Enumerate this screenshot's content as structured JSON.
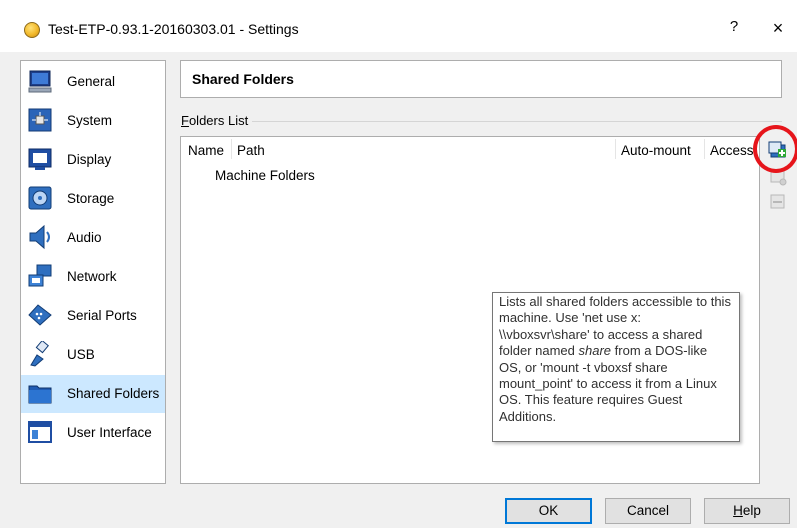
{
  "window": {
    "title": "Test-ETP-0.93.1-20160303.01 - Settings",
    "help_label": "?",
    "close_label": "×"
  },
  "sidebar": {
    "items": [
      {
        "label": "General",
        "icon": "monitor-icon"
      },
      {
        "label": "System",
        "icon": "chip-icon"
      },
      {
        "label": "Display",
        "icon": "display-icon"
      },
      {
        "label": "Storage",
        "icon": "disk-icon"
      },
      {
        "label": "Audio",
        "icon": "speaker-icon"
      },
      {
        "label": "Network",
        "icon": "network-icon"
      },
      {
        "label": "Serial Ports",
        "icon": "serial-port-icon"
      },
      {
        "label": "USB",
        "icon": "usb-icon"
      },
      {
        "label": "Shared Folders",
        "icon": "folder-icon",
        "selected": true
      },
      {
        "label": "User Interface",
        "icon": "window-icon"
      }
    ]
  },
  "page": {
    "title": "Shared Folders",
    "group_label_accel": "F",
    "group_label_rest": "olders List"
  },
  "table": {
    "columns": [
      "Name",
      "Path",
      "Auto-mount",
      "Access"
    ],
    "rows": [
      {
        "label": "Machine Folders"
      }
    ]
  },
  "tooltip": {
    "text_before": "Lists all shared folders accessible to this machine. Use 'net use x: \\\\vboxsvr\\share' to access a shared folder named ",
    "text_em": "share",
    "text_after": " from a DOS-like OS, or 'mount -t vboxsf share mount_point' to access it from a Linux OS. This feature requires Guest Additions."
  },
  "toolbar": {
    "add_icon": "add-shared-folder-icon",
    "edit_icon": "edit-shared-folder-icon",
    "remove_icon": "remove-shared-folder-icon"
  },
  "buttons": {
    "ok": "OK",
    "cancel": "Cancel",
    "help_accel": "H",
    "help_rest": "elp"
  },
  "colors": {
    "selection": "#cce8ff",
    "highlight_circle": "#e6151b",
    "default_button_border": "#0078d7"
  }
}
